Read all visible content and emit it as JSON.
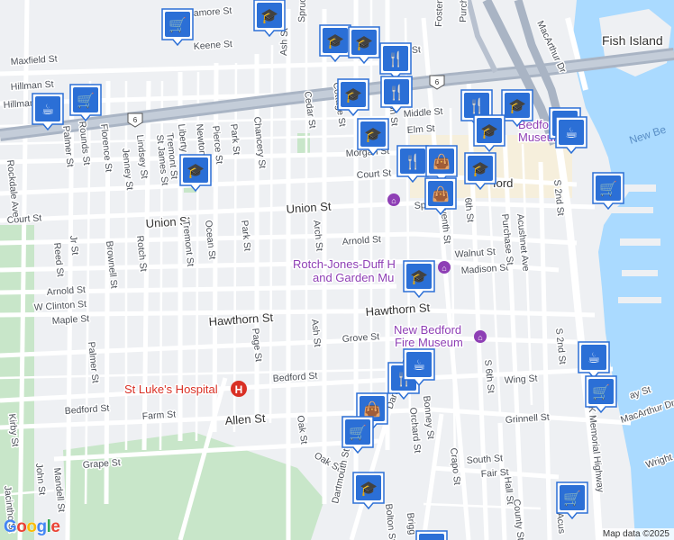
{
  "map": {
    "places": [
      {
        "name": "Fish Island"
      }
    ],
    "water_labels": [
      {
        "name": "New Be"
      }
    ],
    "route_shields": [
      "6",
      "6"
    ],
    "streets": [
      "amore St",
      "Maxfield St",
      "Keene St",
      "Hillman St",
      "Spruce St",
      "Ash St",
      "rth St",
      "Foster St",
      "Purch",
      "MacArthur Dr",
      "Middle St",
      "Elm St",
      "Morgan St",
      "Court St",
      "Cottage St",
      "Cedar St",
      "Union St",
      "Union St",
      "Court St",
      "Arnold St",
      "Walnut St",
      "Madison St",
      "Arnold St",
      "W Clinton St",
      "Maple St",
      "Hawthorn St",
      "Hawthorn St",
      "Grove St",
      "Bedford St",
      "Bedford St",
      "Farm St",
      "Allen St",
      "Wing St",
      "Grinnell St",
      "South St",
      "Fair St",
      "Grape St",
      "Oak St",
      "Oak St",
      "Rockdale Ave",
      "Palmer St",
      "Rounds St",
      "Florence St",
      "Jenney St",
      "Lindsey St",
      "St James St",
      "Tremont St",
      "Liberty St",
      "Newton St",
      "Pierce St",
      "Park St",
      "Chancery St",
      "Ocean St",
      "Park St",
      "Tremont St",
      "Brownell St",
      "Rotch St",
      "Reed St",
      "Jr St",
      "Page St",
      "Ash St",
      "Arch St",
      "Palmer St",
      "Kirby St",
      "John St",
      "Mandell St",
      "Jacintho St",
      "S 6th St",
      "S 2nd St",
      "S 2nd St",
      "Purchase St",
      "Acushnet Ave",
      "Bonney St",
      "Orchard St",
      "Crapo St",
      "Hall St",
      "County St",
      "Dartmouth St",
      "Dartmouth St",
      "Bolton St",
      "Brigg",
      "Acus",
      "ay St",
      "MacArthur Dr",
      "Wright",
      "JFK Memorial Highway",
      "6th St",
      "Spring St",
      "Hillman St",
      "Nelson St",
      "Seventh St"
    ],
    "pois": [
      {
        "name": "Rotch-Jones-Duff House and Garden Museum",
        "lines": [
          "Rotch-Jones-Duff H",
          "and Garden Mu"
        ]
      },
      {
        "name": "New Bedford Fire Museum",
        "lines": [
          "New Bedford",
          "Fire Museum"
        ]
      },
      {
        "name": "St Luke's Hospital",
        "lines": [
          "St Luke's Hospital"
        ]
      },
      {
        "name": "New Bedford Whaling Museum",
        "lines": [
          "Bedford",
          "Museum"
        ]
      },
      {
        "name": "ford",
        "lines": [
          "ford"
        ]
      }
    ],
    "markers": [
      {
        "type": "grocery"
      },
      {
        "type": "school"
      },
      {
        "type": "school"
      },
      {
        "type": "school"
      },
      {
        "type": "restaurant"
      },
      {
        "type": "grocery"
      },
      {
        "type": "cafe"
      },
      {
        "type": "school"
      },
      {
        "type": "restaurant"
      },
      {
        "type": "school"
      },
      {
        "type": "restaurant"
      },
      {
        "type": "school"
      },
      {
        "type": "cafe"
      },
      {
        "type": "cafe"
      },
      {
        "type": "school"
      },
      {
        "type": "restaurant"
      },
      {
        "type": "shopping"
      },
      {
        "type": "school"
      },
      {
        "type": "shopping"
      },
      {
        "type": "grocery"
      },
      {
        "type": "school"
      },
      {
        "type": "school"
      },
      {
        "type": "restaurant"
      },
      {
        "type": "cafe"
      },
      {
        "type": "cafe"
      },
      {
        "type": "grocery"
      },
      {
        "type": "shopping"
      },
      {
        "type": "grocery"
      },
      {
        "type": "school"
      },
      {
        "type": "grocery"
      },
      {
        "type": "school"
      }
    ]
  },
  "attribution": "Map data ©2025",
  "logo": "Google",
  "colors": {
    "water": "#aadaff",
    "park": "#c8e6c9",
    "road": "#ffffff",
    "highway": "#a9b4c4",
    "marker_fill": "#1a73e8",
    "poi": "#8e3fb5",
    "hospital": "#d93025"
  }
}
